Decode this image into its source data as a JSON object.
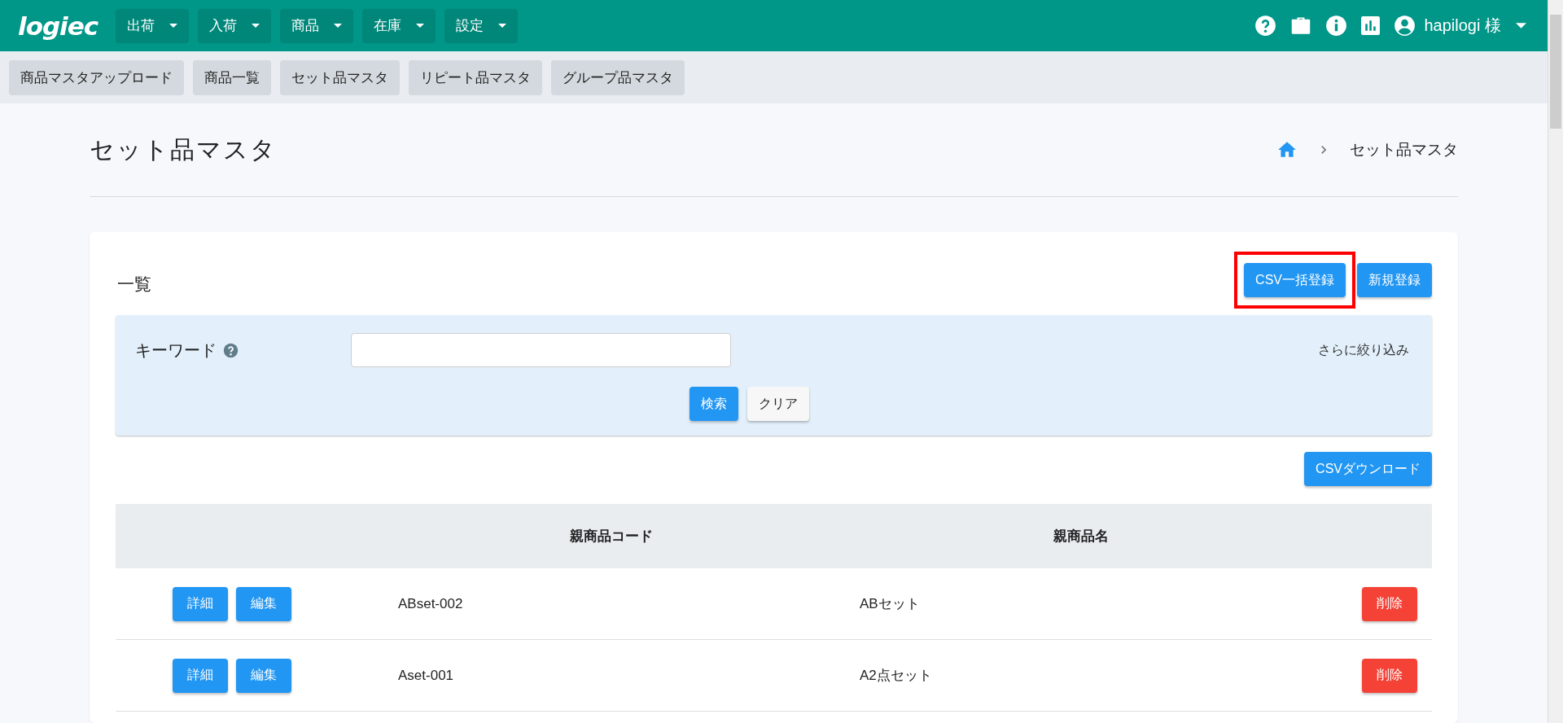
{
  "header": {
    "logo": "logiec",
    "menus": [
      {
        "label": "出荷"
      },
      {
        "label": "入荷"
      },
      {
        "label": "商品"
      },
      {
        "label": "在庫"
      },
      {
        "label": "設定"
      }
    ],
    "user": "hapilogi 様"
  },
  "subnav": [
    {
      "label": "商品マスタアップロード"
    },
    {
      "label": "商品一覧"
    },
    {
      "label": "セット品マスタ"
    },
    {
      "label": "リピート品マスタ"
    },
    {
      "label": "グループ品マスタ"
    }
  ],
  "page": {
    "title": "セット品マスタ",
    "breadcrumb": [
      "セット品マスタ"
    ]
  },
  "card": {
    "title": "一覧",
    "actions": [
      {
        "label": "CSV一括登録",
        "highlighted": true
      },
      {
        "label": "新規登録",
        "highlighted": false
      }
    ],
    "filter": {
      "label": "キーワード",
      "more": "さらに絞り込み",
      "buttons": [
        {
          "label": "検索",
          "kind": "primary"
        },
        {
          "label": "クリア",
          "kind": "plain"
        }
      ]
    },
    "download": "CSVダウンロード",
    "table": {
      "columns": [
        "親商品コード",
        "親商品名"
      ],
      "rows": [
        {
          "buttons": [
            "詳細",
            "編集"
          ],
          "code": "ABset-002",
          "name": "ABセット",
          "delete": "削除"
        },
        {
          "buttons": [
            "詳細",
            "編集"
          ],
          "code": "Aset-001",
          "name": "A2点セット",
          "delete": "削除"
        }
      ]
    }
  }
}
